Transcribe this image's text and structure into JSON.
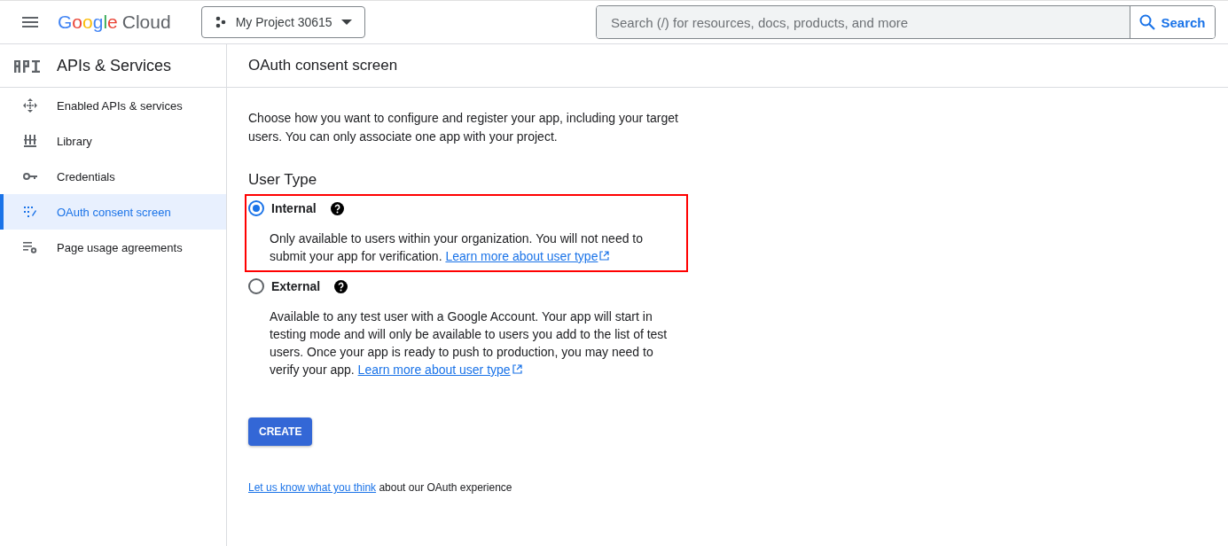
{
  "topbar": {
    "logo_brand": "Google",
    "logo_product": "Cloud",
    "project": "My Project 30615",
    "search": {
      "placeholder": "Search (/) for resources, docs, products, and more",
      "button": "Search"
    }
  },
  "sidebar": {
    "title": "APIs & Services",
    "items": [
      {
        "label": "Enabled APIs & services",
        "selected": false
      },
      {
        "label": "Library",
        "selected": false
      },
      {
        "label": "Credentials",
        "selected": false
      },
      {
        "label": "OAuth consent screen",
        "selected": true
      },
      {
        "label": "Page usage agreements",
        "selected": false
      }
    ]
  },
  "page": {
    "title": "OAuth consent screen",
    "intro": "Choose how you want to configure and register your app, including your target users. You can only associate one app with your project.",
    "section_title": "User Type",
    "options": [
      {
        "label": "Internal",
        "selected": true,
        "highlighted": true,
        "description": "Only available to users within your organization. You will not need to submit your app for verification.",
        "link": "Learn more about user type"
      },
      {
        "label": "External",
        "selected": false,
        "highlighted": false,
        "description": "Available to any test user with a Google Account. Your app will start in testing mode and will only be available to users you add to the list of test users. Once your app is ready to push to production, you may need to verify your app.",
        "link": "Learn more about user type"
      }
    ],
    "create_button": "CREATE",
    "feedback": {
      "link": "Let us know what you think",
      "text": "about our OAuth experience"
    }
  }
}
